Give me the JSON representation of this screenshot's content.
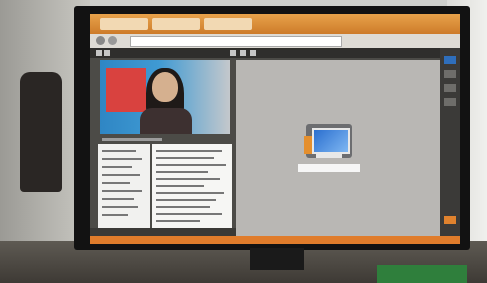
{
  "scene": {
    "description": "photo",
    "colors": {
      "titlebar": "#cd7b2a",
      "canvas": "#b9b7b4",
      "video_bg": "#2f86c4",
      "bottom_bar": "#e07c2b"
    }
  },
  "icons": {
    "app_icon": "computer-monitor-icon"
  }
}
